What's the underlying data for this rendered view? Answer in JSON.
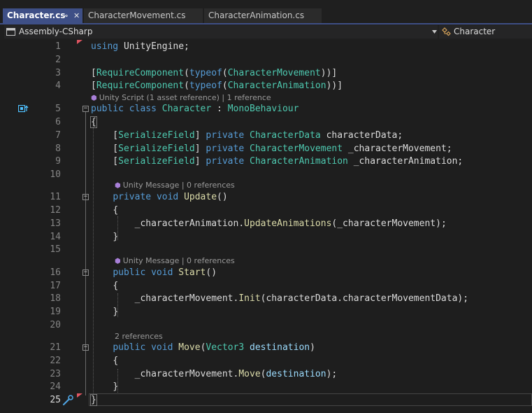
{
  "tabs": [
    {
      "label": "Character.cs",
      "active": true
    },
    {
      "label": "CharacterMovement.cs",
      "active": false
    },
    {
      "label": "CharacterAnimation.cs",
      "active": false
    }
  ],
  "tab_pin_glyph": "⊸",
  "tab_close_glyph": "✕",
  "nav": {
    "project": "Assembly-CSharp",
    "member": "Character"
  },
  "codelens": {
    "unity_script": "Unity Script (1 asset reference) | 1 reference",
    "update_msg": "Unity Message | 0 references",
    "start_msg": "Unity Message | 0 references",
    "move_refs": "2 references"
  },
  "line_numbers": [
    "1",
    "2",
    "3",
    "4",
    "5",
    "6",
    "7",
    "8",
    "9",
    "10",
    "11",
    "12",
    "13",
    "14",
    "15",
    "16",
    "17",
    "18",
    "19",
    "20",
    "21",
    "22",
    "23",
    "24",
    "25"
  ],
  "code": {
    "l1": {
      "kw": "using",
      "rest": " UnityEngine;"
    },
    "l3": {
      "open": "[",
      "attr": "RequireComponent",
      "p1": "(",
      "kw": "typeof",
      "p2": "(",
      "type": "CharacterMovement",
      "close": "))]"
    },
    "l4": {
      "open": "[",
      "attr": "RequireComponent",
      "p1": "(",
      "kw": "typeof",
      "p2": "(",
      "type": "CharacterAnimation",
      "close": "))]"
    },
    "l5": {
      "kw1": "public",
      "kw2": "class",
      "name": "Character",
      "colon": " : ",
      "base": "MonoBehaviour"
    },
    "brace_open": "{",
    "brace_close": "}",
    "l7": {
      "attr": "SerializeField",
      "kw": "private",
      "type": "CharacterData",
      "field": " characterData;"
    },
    "l8": {
      "attr": "SerializeField",
      "kw": "private",
      "type": "CharacterMovement",
      "field": " _characterMovement;"
    },
    "l9": {
      "attr": "SerializeField",
      "kw": "private",
      "type": "CharacterAnimation",
      "field": " _characterAnimation;"
    },
    "l11": {
      "kw1": "private",
      "kw2": "void",
      "method": "Update",
      "sig": "()"
    },
    "l13": {
      "obj": "_characterAnimation.",
      "method": "UpdateAnimations",
      "args": "(_characterMovement);"
    },
    "l16": {
      "kw1": "public",
      "kw2": "void",
      "method": "Start",
      "sig": "()"
    },
    "l18": {
      "obj": "_characterMovement.",
      "method": "Init",
      "args": "(characterData.characterMovementData);"
    },
    "l21": {
      "kw1": "public",
      "kw2": "void",
      "method": "Move",
      "p1": "(",
      "type": "Vector3",
      "param": " destination",
      "p2": ")"
    },
    "l23": {
      "obj": "_characterMovement.",
      "method": "Move",
      "p1": "(",
      "param": "destination",
      "p2": ");"
    }
  },
  "colors": {
    "keyword": "#569cd6",
    "type": "#4ec9b0",
    "method": "#dcdcaa",
    "param": "#9cdcfe",
    "text": "#dcdcdc",
    "accent": "#3e4f86"
  }
}
